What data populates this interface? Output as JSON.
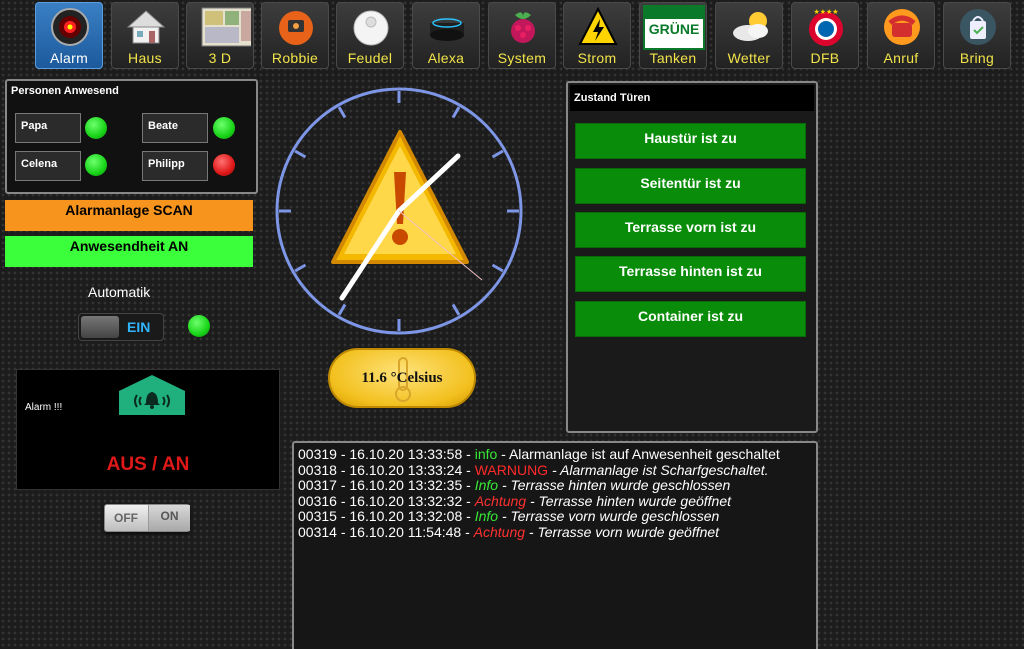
{
  "nav": [
    {
      "label": "Alarm",
      "icon": "hal-eye-icon",
      "active": true
    },
    {
      "label": "Haus",
      "icon": "house-icon",
      "active": false
    },
    {
      "label": "3 D",
      "icon": "floorplan-3d-icon",
      "active": false
    },
    {
      "label": "Robbie",
      "icon": "robot-vacuum-icon",
      "active": false
    },
    {
      "label": "Feudel",
      "icon": "mop-robot-icon",
      "active": false
    },
    {
      "label": "Alexa",
      "icon": "echo-speaker-icon",
      "active": false
    },
    {
      "label": "System",
      "icon": "raspberry-pi-icon",
      "active": false
    },
    {
      "label": "Strom",
      "icon": "high-voltage-icon",
      "active": false
    },
    {
      "label": "Tanken",
      "icon": "gas-station-icon",
      "active": false
    },
    {
      "label": "Wetter",
      "icon": "weather-cloud-sun-icon",
      "active": false
    },
    {
      "label": "DFB",
      "icon": "bayern-logo-icon",
      "active": false
    },
    {
      "label": "Anruf",
      "icon": "phone-icon",
      "active": false
    },
    {
      "label": "Bring",
      "icon": "shopping-bag-icon",
      "active": false
    }
  ],
  "tanken_logo_text": "GRÜNE",
  "persons": {
    "title": "Personen Anwesend",
    "items": [
      {
        "name": "Papa",
        "present": true
      },
      {
        "name": "Beate",
        "present": true
      },
      {
        "name": "Celena",
        "present": true
      },
      {
        "name": "Philipp",
        "present": false
      }
    ]
  },
  "alarm_scan_label": "Alarmanlage SCAN",
  "presence_label": "Anwesendheit AN",
  "automatik": {
    "label": "Automatik",
    "toggle_text": "EIN",
    "state": "on"
  },
  "alarm_box": {
    "label": "Alarm !!!",
    "status": "AUS / AN"
  },
  "offon": {
    "off_label": "OFF",
    "on_label": "ON"
  },
  "clock": {
    "icon": "warning-triangle-icon"
  },
  "temperature": {
    "text": "11.6 °Celsius"
  },
  "doors": {
    "title": "Zustand Türen",
    "items": [
      "Haustür ist zu",
      "Seitentür ist zu",
      "Terrasse vorn ist zu",
      "Terrasse hinten ist zu",
      "Container ist zu"
    ]
  },
  "log": [
    {
      "prefix": "00319 - 16.10.20 13:33:58 - ",
      "level": "info",
      "level_class": "lvl-info-plain",
      "message": " - Alarmanlage ist auf Anwesenheit geschaltet"
    },
    {
      "prefix": "00318 - 16.10.20 13:33:24 - ",
      "level": "WARNUNG",
      "level_class": "lvl-warn",
      "message": " - Alarmanlage ist Scharfgeschaltet."
    },
    {
      "prefix": "00317 - 16.10.20 13:32:35 - ",
      "level": "Info",
      "level_class": "lvl-info",
      "message": " - Terrasse hinten wurde geschlossen"
    },
    {
      "prefix": "00316 - 16.10.20 13:32:32 - ",
      "level": "Achtung",
      "level_class": "lvl-acht",
      "message": " - Terrasse hinten wurde geöffnet"
    },
    {
      "prefix": "00315 - 16.10.20 13:32:08 - ",
      "level": "Info",
      "level_class": "lvl-info",
      "message": " - Terrasse vorn wurde geschlossen"
    },
    {
      "prefix": "00314 - 16.10.20 11:54:48 - ",
      "level": "Achtung",
      "level_class": "lvl-acht",
      "message": " - Terrasse vorn wurde geöffnet"
    }
  ],
  "colors": {
    "accent_nav_label": "#f2e44a",
    "door_ok": "#098c09",
    "alarm_scan": "#f7941d",
    "presence_on": "#3aff3a",
    "alarm_status": "#e01818"
  }
}
